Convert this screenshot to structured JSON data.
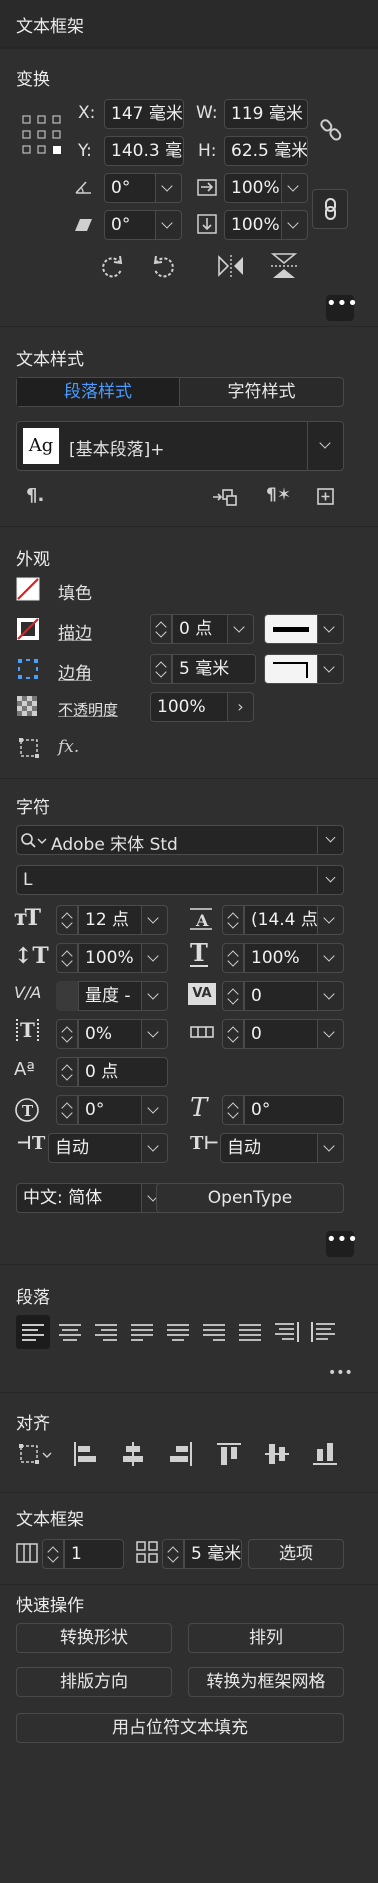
{
  "panel": {
    "title": "文本框架"
  },
  "transform": {
    "title": "变换",
    "x_label": "X:",
    "x_value": "147 毫米",
    "y_label": "Y:",
    "y_value": "140.3 毫",
    "w_label": "W:",
    "w_value": "119 毫米",
    "h_label": "H:",
    "h_value": "62.5 毫米",
    "rotate": "0°",
    "shear": "0°",
    "scale_x": "100%",
    "scale_y": "100%"
  },
  "text_style": {
    "title": "文本样式",
    "tabs": [
      "段落样式",
      "字符样式"
    ],
    "style_preview": "Ag",
    "style_name": "[基本段落]+"
  },
  "appearance": {
    "title": "外观",
    "fill_label": "填色",
    "stroke_label": "描边",
    "stroke_value": "0 点",
    "corner_label": "边角",
    "corner_value": "5 毫米",
    "opacity_label": "不透明度",
    "opacity_value": "100%",
    "fx_label": "fx."
  },
  "character": {
    "title": "字符",
    "font_family": "Adobe 宋体 Std",
    "font_style": "L",
    "font_size": "12 点",
    "leading": "(14.4 点",
    "vert_scale": "100%",
    "horiz_scale": "100%",
    "kerning": "量度 -",
    "tracking": "0",
    "tsume": "0%",
    "aki": "0",
    "baseline_shift": "0 点",
    "char_rotation": "0°",
    "skew": "0°",
    "mojikumi_left": "自动",
    "mojikumi_right": "自动",
    "language": "中文: 简体",
    "opentype": "OpenType"
  },
  "paragraph": {
    "title": "段落"
  },
  "align": {
    "title": "对齐"
  },
  "text_frame": {
    "title": "文本框架",
    "columns": "1",
    "gutter": "5 毫米",
    "options": "选项"
  },
  "quick_actions": {
    "title": "快速操作",
    "convert_shape": "转换形状",
    "arrange": "排列",
    "type_direction": "排版方向",
    "convert_grid": "转换为框架网格",
    "fill_placeholder": "用占位符文本填充"
  }
}
